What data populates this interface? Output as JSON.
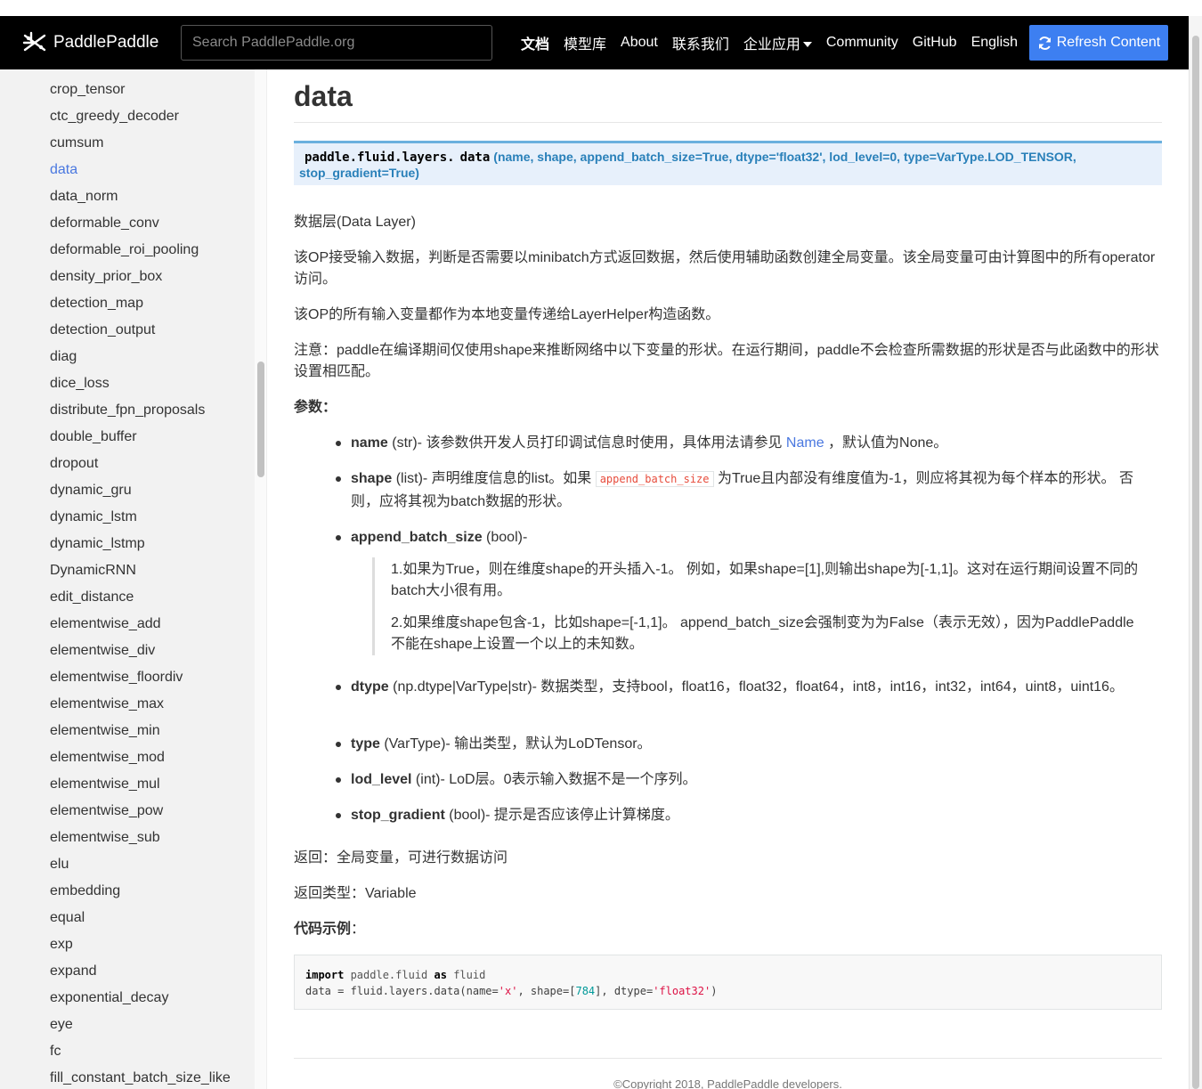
{
  "navbar": {
    "brand": "PaddlePaddle",
    "search_placeholder": "Search PaddlePaddle.org",
    "links": [
      "文档",
      "模型库",
      "About",
      "联系我们",
      "企业应用",
      "Community",
      "GitHub",
      "English"
    ],
    "refresh_label": "Refresh Content",
    "accent": "#3d7ff1"
  },
  "sidebar": {
    "active": "data",
    "items": [
      "crop_tensor",
      "ctc_greedy_decoder",
      "cumsum",
      "data",
      "data_norm",
      "deformable_conv",
      "deformable_roi_pooling",
      "density_prior_box",
      "detection_map",
      "detection_output",
      "diag",
      "dice_loss",
      "distribute_fpn_proposals",
      "double_buffer",
      "dropout",
      "dynamic_gru",
      "dynamic_lstm",
      "dynamic_lstmp",
      "DynamicRNN",
      "edit_distance",
      "elementwise_add",
      "elementwise_div",
      "elementwise_floordiv",
      "elementwise_max",
      "elementwise_min",
      "elementwise_mod",
      "elementwise_mul",
      "elementwise_pow",
      "elementwise_sub",
      "elu",
      "embedding",
      "equal",
      "exp",
      "expand",
      "exponential_decay",
      "eye",
      "fc",
      "fill_constant_batch_size_like"
    ]
  },
  "doc": {
    "title": "data",
    "sig_module": "paddle.fluid.layers.",
    "sig_name": "data",
    "sig_params_1": "(name, shape, append_batch_size=True, dtype='float32', lod_level=0, type=VarType.LOD_TENSOR,",
    "sig_params_2": "stop_gradient=True)",
    "p1": "数据层(Data Layer)",
    "p2": "该OP接受输入数据，判断是否需要以minibatch方式返回数据，然后使用辅助函数创建全局变量。该全局变量可由计算图中的所有operator访问。",
    "p3": "该OP的所有输入变量都作为本地变量传递给LayerHelper构造函数。",
    "p4": "注意：paddle在编译期间仅使用shape来推断网络中以下变量的形状。在运行期间，paddle不会检查所需数据的形状是否与此函数中的形状设置相匹配。",
    "params_label": "参数：",
    "name_term": "name",
    "name_type": " (str)- 该参数供开发人员打印调试信息时使用，具体用法请参见 ",
    "name_link": "Name",
    "name_tail": " ，默认值为None。",
    "shape_term": "shape",
    "shape_a": " (list)- 声明维度信息的list。如果 ",
    "shape_code": "append_batch_size",
    "shape_b": " 为True且内部没有维度值为-1，则应将其视为每个样本的形状。 否则，应将其视为batch数据的形状。",
    "abs_term": "append_batch_size",
    "abs_type": " (bool)-",
    "abs_q1": "1.如果为True，则在维度shape的开头插入-1。 例如，如果shape=[1],则输出shape为[-1,1]。这对在运行期间设置不同的batch大小很有用。",
    "abs_q2": "2.如果维度shape包含-1，比如shape=[-1,1]。 append_batch_size会强制变为为False（表示无效），因为PaddlePaddle不能在shape上设置一个以上的未知数。",
    "dtype_term": "dtype",
    "dtype_desc": " (np.dtype|VarType|str)- 数据类型，支持bool，float16，float32，float64，int8，int16，int32，int64，uint8，uint16。",
    "type_term": "type",
    "type_desc": " (VarType)- 输出类型，默认为LoDTensor。",
    "lod_term": "lod_level",
    "lod_desc": " (int)- LoD层。0表示输入数据不是一个序列。",
    "sg_term": "stop_gradient",
    "sg_desc": " (bool)- 提示是否应该停止计算梯度。",
    "returns": "返回：全局变量，可进行数据访问",
    "return_type": "返回类型：Variable",
    "example_label": "代码示例",
    "example_colon": "：",
    "code_kw1": "import",
    "code_mod": " paddle.fluid ",
    "code_kw2": "as",
    "code_alias": " fluid",
    "code_l2a": "data = fluid.layers.data(name=",
    "code_str1": "'x'",
    "code_l2b": ", shape=[",
    "code_num": "784",
    "code_l2c": "], dtype=",
    "code_str2": "'float32'",
    "code_l2d": ")",
    "footer": "©Copyright 2018, PaddlePaddle developers."
  }
}
